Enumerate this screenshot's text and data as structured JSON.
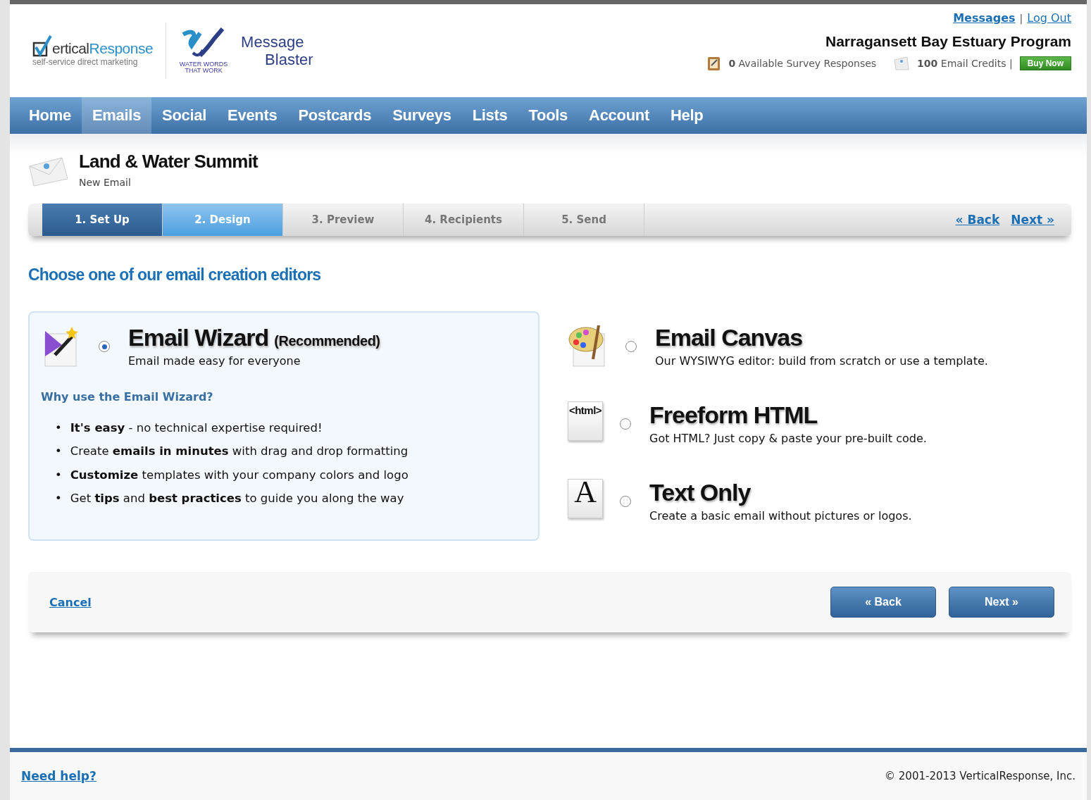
{
  "header": {
    "link_separator": "|",
    "links": [
      {
        "label": "Messages",
        "bold": true
      },
      {
        "label": "Log Out",
        "bold": false
      }
    ],
    "logo": {
      "name_start": "ertical",
      "name_end": "Response",
      "tagline": "self-service direct marketing"
    },
    "partner_logo": {
      "line_1": "WATER WORDS",
      "line_2": "THAT WORK",
      "product_1": "Message",
      "product_2": "Blaster"
    },
    "organization": "Narragansett Bay Estuary Program",
    "survey": {
      "count": "0",
      "label": "Available Survey Responses"
    },
    "credits": {
      "count": "100",
      "label": "Email Credits |"
    },
    "buy_button": "Buy Now"
  },
  "nav": [
    {
      "label": "Home",
      "selected": false
    },
    {
      "label": "Emails",
      "selected": true
    },
    {
      "label": "Social",
      "selected": false
    },
    {
      "label": "Events",
      "selected": false
    },
    {
      "label": "Postcards",
      "selected": false
    },
    {
      "label": "Surveys",
      "selected": false
    },
    {
      "label": "Lists",
      "selected": false
    },
    {
      "label": "Tools",
      "selected": false
    },
    {
      "label": "Account",
      "selected": false
    },
    {
      "label": "Help",
      "selected": false
    }
  ],
  "page": {
    "title": "Land & Water Summit",
    "subtitle": "New Email"
  },
  "steps": [
    {
      "label": "1. Set Up",
      "completed": true,
      "selected": false
    },
    {
      "label": "2. Design",
      "completed": false,
      "selected": true
    },
    {
      "label": "3. Preview",
      "completed": false,
      "selected": false
    },
    {
      "label": "4. Recipients",
      "completed": false,
      "selected": false
    },
    {
      "label": "5. Send",
      "completed": false,
      "selected": false
    }
  ],
  "step_links": [
    "« Back",
    "Next »"
  ],
  "heading": "Choose one of our email creation editors",
  "featured_editor": {
    "kind": "wizard",
    "title": "Email Wizard",
    "note": "(Recommended)",
    "description": "Email made easy for everyone",
    "selected": true,
    "why_heading": "Why use the Email Wizard?",
    "bullet": "•",
    "benefits": [
      "**It's easy** - no technical expertise required!",
      "Create **emails in minutes** with drag and drop formatting",
      "**Customize** templates with your company colors and logo",
      "Get **tips** and **best practices** to guide you along the way"
    ]
  },
  "editors": [
    {
      "kind": "canvas",
      "title": "Email Canvas",
      "description": "Our WYSIWYG editor: build from scratch or use a template.",
      "selected": false
    },
    {
      "kind": "html",
      "icon_text": "<html>",
      "title": "Freeform HTML",
      "description": "Got HTML?  Just copy & paste your pre-built code.",
      "selected": false
    },
    {
      "kind": "text",
      "icon_text": "A",
      "title": "Text Only",
      "description": "Create a basic email without pictures or logos.",
      "selected": false
    }
  ],
  "actions": {
    "cancel": "Cancel",
    "back": "« Back",
    "next": "Next »"
  },
  "footer": {
    "help": "Need help?",
    "copyright": "© 2001-2013 VerticalResponse, Inc."
  }
}
